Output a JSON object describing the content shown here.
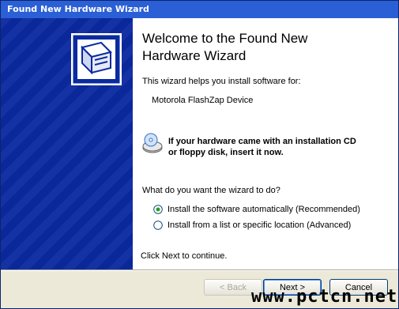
{
  "window": {
    "title": "Found New Hardware Wizard"
  },
  "content": {
    "heading_line1": "Welcome to the Found New",
    "heading_line2": "Hardware Wizard",
    "intro": "This wizard helps you install software for:",
    "device": "Motorola FlashZap Device",
    "cd_note_line1": "If your hardware came with an installation CD",
    "cd_note_line2": "or floppy disk, insert it now.",
    "question": "What do you want the wizard to do?",
    "options": [
      {
        "label": "Install the software automatically (Recommended)",
        "selected": true
      },
      {
        "label": "Install from a list or specific location (Advanced)",
        "selected": false
      }
    ],
    "continue_text": "Click Next to continue."
  },
  "buttons": {
    "back": "< Back",
    "next": "Next >",
    "cancel": "Cancel"
  },
  "watermark": "www.pctcn.net",
  "colors": {
    "title_bar": "#2b5fd6",
    "side_panel": "#0a2a9f",
    "face": "#ece9d8"
  }
}
